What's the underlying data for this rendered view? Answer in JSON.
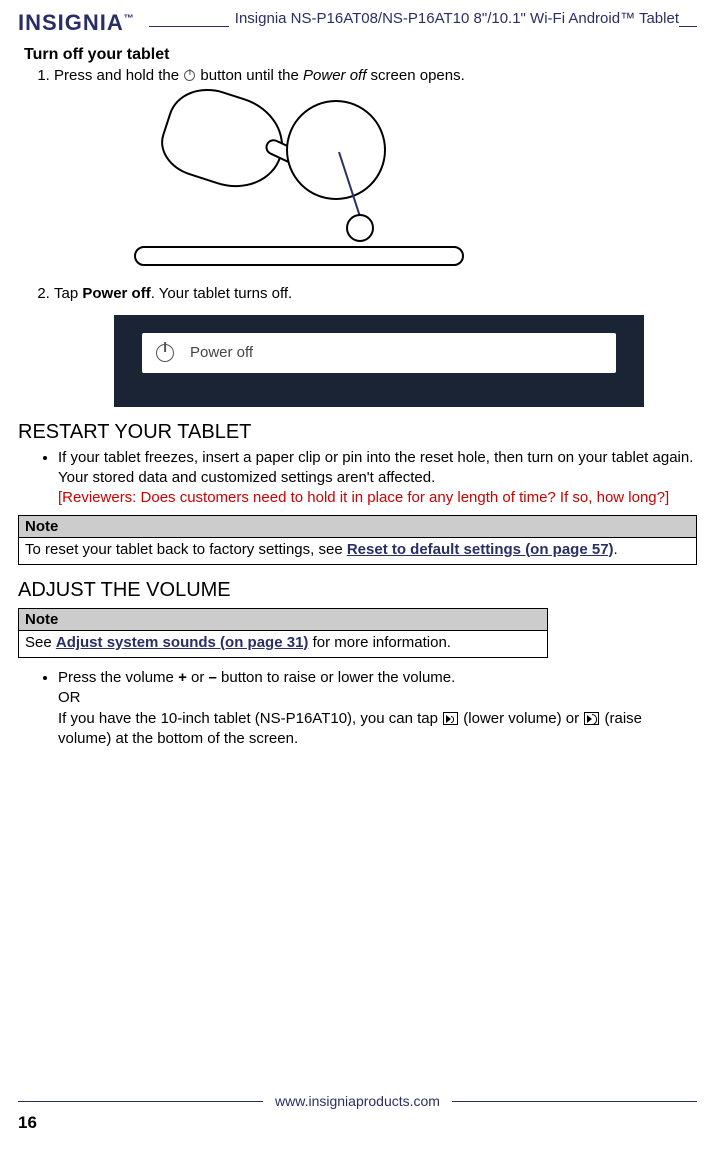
{
  "header": {
    "logo": "INSIGNIA",
    "logo_tm": "™",
    "doc_title": "Insignia  NS-P16AT08/NS-P16AT10  8\"/10.1\" Wi-Fi Android™ Tablet"
  },
  "section_turnoff": {
    "title": "Turn off your tablet",
    "step1_a": "Press and hold the ",
    "step1_b": " button until the ",
    "step1_c": "Power off",
    "step1_d": " screen opens.",
    "step2_a": "Tap ",
    "step2_b": "Power off",
    "step2_c": ". Your tablet turns off.",
    "dialog_label": "Power off"
  },
  "section_restart": {
    "heading": "RESTART YOUR TABLET",
    "bullet1": "If your tablet freezes, insert a paper clip or pin into the reset hole, then turn on your tablet again. Your stored data and customized settings aren't affected.",
    "reviewer_note": "[Reviewers: Does customers need to hold it in place for any length of time? If so, how long?]",
    "note_label": "Note",
    "note_body_a": "To reset your tablet back to factory settings, see ",
    "note_link": "Reset to default settings (on page 57)",
    "note_body_b": "."
  },
  "section_volume": {
    "heading": "ADJUST THE VOLUME",
    "note_label": "Note",
    "note_body_a": "See ",
    "note_link": "Adjust system sounds (on page 31)",
    "note_body_b": " for more information.",
    "bullet_a": "Press the volume  ",
    "bullet_plus": "+",
    "bullet_b": " or ",
    "bullet_minus": "–",
    "bullet_c": " button to raise or lower the volume.",
    "or": "OR",
    "line2_a": "If you have the 10-inch tablet (NS-P16AT10), you can tap ",
    "line2_b": " (lower volume) or ",
    "line2_c": " (raise volume) at the bottom of the screen."
  },
  "footer": {
    "url": "www.insigniaproducts.com",
    "page_number": "16"
  }
}
